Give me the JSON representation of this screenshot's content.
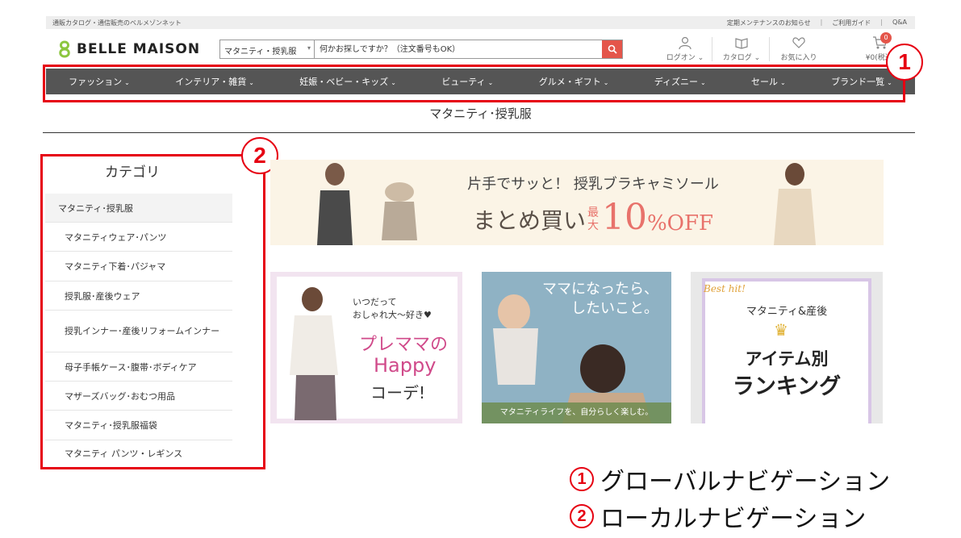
{
  "topbar": {
    "tagline": "通販カタログ・通信販売のベルメゾンネット",
    "links": [
      "定期メンテナンスのお知らせ",
      "ご利用ガイド",
      "Q&A"
    ],
    "separator": "|"
  },
  "header": {
    "logo": "BELLE MAISON",
    "search": {
      "category": "マタニティ・授乳服",
      "placeholder": "何かお探しですか？（注文番号もOK）"
    },
    "utilities": [
      {
        "label": "ログオン",
        "icon": "user-icon"
      },
      {
        "label": "カタログ",
        "icon": "book-icon"
      },
      {
        "label": "お気に入り",
        "icon": "heart-icon"
      },
      {
        "label": "¥0(税込)",
        "icon": "cart-icon"
      }
    ],
    "cart_count": "0"
  },
  "global_nav": {
    "items": [
      "ファッション",
      "インテリア・雑貨",
      "妊娠・ベビー・キッズ",
      "ビューティ",
      "グルメ・ギフト",
      "ディズニー",
      "セール",
      "ブランド一覧"
    ]
  },
  "page": {
    "title": "マタニティ･授乳服"
  },
  "sidebar": {
    "title": "カテゴリ",
    "header_item": "マタニティ･授乳服",
    "items": [
      "マタニティウェア･パンツ",
      "マタニティ下着･パジャマ",
      "授乳服･産後ウェア",
      "授乳インナー･産後リフォームインナー",
      "母子手帳ケース･腹帯･ボディケア",
      "マザーズバッグ･おむつ用品",
      "マタニティ･授乳服福袋",
      "マタニティ パンツ・レギンス"
    ]
  },
  "banner": {
    "line1": "片手でサッと！ 授乳ブラキャミソール",
    "line2_a": "まとめ買い",
    "line2_b": "最大",
    "line2_c": "10",
    "line2_d": "%OFF"
  },
  "tiles": {
    "t1": {
      "line1": "いつだって",
      "line2": "おしゃれ大〜好き♥",
      "line3": "プレママの",
      "line4": "Happy",
      "line5": "コーデ!"
    },
    "t2": {
      "line1": "ママになったら、",
      "line2": "したいこと。",
      "footer": "マタニティライフを、自分らしく楽しむ。"
    },
    "t3": {
      "hit": "Best hit!",
      "line1": "マタニティ&産後",
      "line2": "アイテム別",
      "line3": "ランキング"
    }
  },
  "annotations": {
    "callout1": "1",
    "callout2": "2",
    "legend": [
      {
        "num": "1",
        "text": "グローバルナビゲーション"
      },
      {
        "num": "2",
        "text": "ローカルナビゲーション"
      }
    ]
  },
  "colors": {
    "nav_bg": "#555555",
    "accent": "#e4554a",
    "annotation_red": "#e60012"
  }
}
